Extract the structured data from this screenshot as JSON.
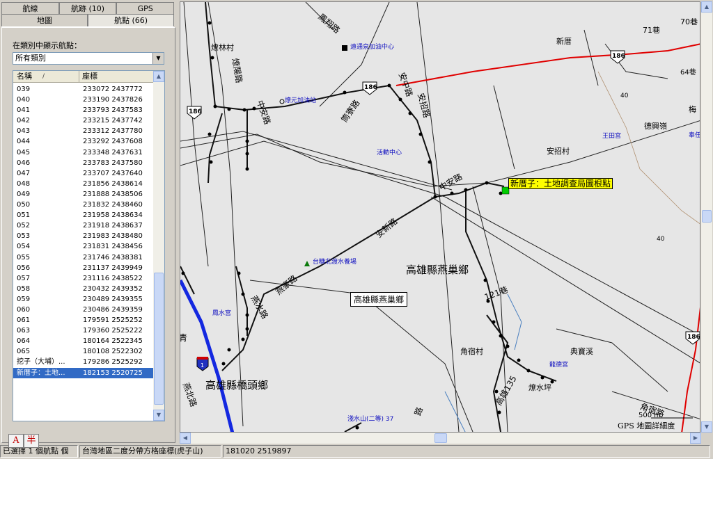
{
  "tabs_row1": [
    "航線",
    "航跡 (10)",
    "GPS"
  ],
  "tabs_row2": [
    "地圖",
    "航點 (66)"
  ],
  "category": {
    "label": "在類別中顯示航點：",
    "selected": "所有類別"
  },
  "list": {
    "col_name": "名稱",
    "col_coord": "座標",
    "sort_indicator": "/",
    "rows": [
      {
        "name": "039",
        "coord": "233072 2437772"
      },
      {
        "name": "040",
        "coord": "233190 2437826"
      },
      {
        "name": "041",
        "coord": "233793 2437583"
      },
      {
        "name": "042",
        "coord": "233215 2437742"
      },
      {
        "name": "043",
        "coord": "233312 2437780"
      },
      {
        "name": "044",
        "coord": "233292 2437608"
      },
      {
        "name": "045",
        "coord": "233348 2437631"
      },
      {
        "name": "046",
        "coord": "233783 2437580"
      },
      {
        "name": "047",
        "coord": "233707 2437640"
      },
      {
        "name": "048",
        "coord": "231856 2438614"
      },
      {
        "name": "049",
        "coord": "231888 2438506"
      },
      {
        "name": "050",
        "coord": "231832 2438460"
      },
      {
        "name": "051",
        "coord": "231958 2438634"
      },
      {
        "name": "052",
        "coord": "231918 2438637"
      },
      {
        "name": "053",
        "coord": "231983 2438480"
      },
      {
        "name": "054",
        "coord": "231831 2438456"
      },
      {
        "name": "055",
        "coord": "231746 2438381"
      },
      {
        "name": "056",
        "coord": "231137 2439949"
      },
      {
        "name": "057",
        "coord": "231116 2438522"
      },
      {
        "name": "058",
        "coord": "230432 2439352"
      },
      {
        "name": "059",
        "coord": "230489 2439355"
      },
      {
        "name": "060",
        "coord": "230486 2439359"
      },
      {
        "name": "061",
        "coord": "179591 2525252"
      },
      {
        "name": "063",
        "coord": "179360 2525222"
      },
      {
        "name": "064",
        "coord": "180164 2522345"
      },
      {
        "name": "065",
        "coord": "180108 2522302"
      },
      {
        "name": "挖子（大埔）...",
        "coord": "179286 2525292"
      },
      {
        "name": "新厝子：土地...",
        "coord": "182153 2520725"
      }
    ],
    "selected_index": 27
  },
  "ime": [
    "A",
    "半"
  ],
  "map": {
    "labels": {
      "liao_lin": "燎林村",
      "shi_lin_road": "鳳翔路",
      "gas1": "遠通泉加油中心",
      "xin_cuo": "新厝",
      "lane71": "71巷",
      "lane70": "70巷",
      "lane64": "64巷",
      "road_186": "186",
      "num40a": "40",
      "num40b": "40",
      "mei": "梅",
      "wang_tian": "王田宮",
      "de_xing": "德興嶺",
      "fa": "奉任",
      "an_zhao": "安招村",
      "gas2": "燎元加油站",
      "huo_dong": "活動中心",
      "yan_zhong": "筒寮路",
      "ping_road": "中安路",
      "an_tong": "安中路",
      "xin_zhou": "安招路",
      "zhong_an": "中安路",
      "tai_tang": "台糖北渡水養場",
      "kao_yan": "高雄縣燕巢鄉",
      "yan_road": "燕豪路",
      "an_xin": "安新路",
      "lane121": "121巷",
      "ji_shui": "鳳水宮",
      "yan_shui_road": "燕水路",
      "jiao_su": "角宿村",
      "dian_bao": "典寶溪",
      "long_de": "龍德宮",
      "liao_shui": "燎水坪",
      "gao_liao": "高雄135",
      "jiao_su_road": "角宿路",
      "yuan_shui": "淺水山(二等) 37",
      "qiao_tou": "高雄縣橋頭鄉",
      "yan_bei": "燕北路",
      "qing": "青",
      "liao_zhong": "燎陽路",
      "lane3": "路",
      "hwy": "1"
    },
    "highlight": "新厝子：土地調查局圖根點",
    "box_label": "高雄縣燕巢鄉",
    "scale": "500 m",
    "detail_label": "GPS 地圖詳細度"
  },
  "status": {
    "selection": "已選擇 1 個航點 個",
    "datum": "台灣地區二度分帶方格座標(虎子山)",
    "coord": "181020 2519897"
  },
  "colors": {
    "road_red": "#e00000",
    "highway_blue": "#1428e0",
    "selection": "#316ac5",
    "waypoint_green": "#00cc00"
  }
}
